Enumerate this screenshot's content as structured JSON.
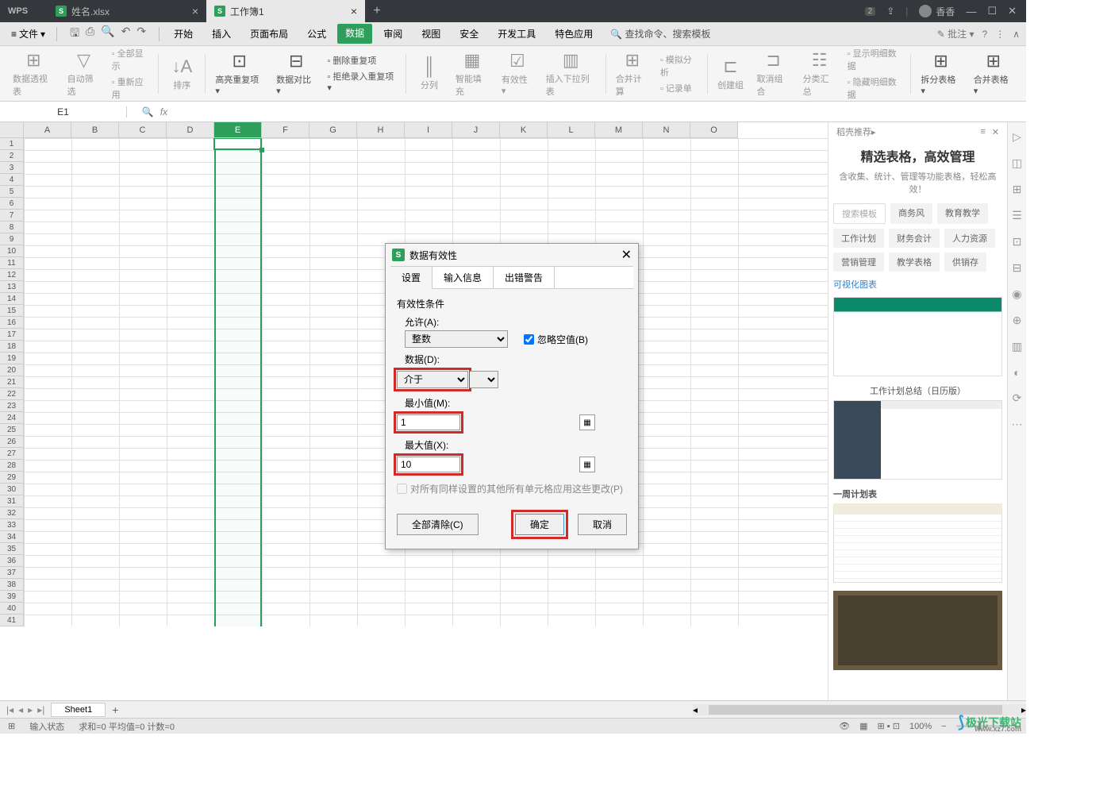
{
  "titlebar": {
    "logo": "WPS",
    "tabs": [
      {
        "name": "姓名.xlsx"
      },
      {
        "name": "工作簿1"
      }
    ],
    "badge": "2",
    "user": "香香"
  },
  "menubar": {
    "file": "文件",
    "items": [
      "开始",
      "插入",
      "页面布局",
      "公式",
      "数据",
      "审阅",
      "视图",
      "安全",
      "开发工具",
      "特色应用"
    ],
    "active_index": 4,
    "search": "查找命令、搜索模板",
    "comment": "批注"
  },
  "ribbon": {
    "groups": [
      {
        "label": "数据透视表",
        "icon": "⊞"
      },
      {
        "label": "自动筛选",
        "icon": "▽"
      },
      {
        "stack": [
          "全部显示",
          "重新应用"
        ]
      },
      {
        "label": "排序",
        "icon": "↓A",
        "sep_before": true
      },
      {
        "label": "高亮重复项",
        "icon": "⊡",
        "dd": true,
        "enabled": true,
        "sep_before": true
      },
      {
        "label": "数据对比",
        "icon": "⊟",
        "dd": true,
        "enabled": true
      },
      {
        "stack": [
          "删除重复项",
          "拒绝录入重复项"
        ],
        "enabled": true
      },
      {
        "label": "分列",
        "icon": "║",
        "sep_before": true
      },
      {
        "label": "智能填充",
        "icon": "▦"
      },
      {
        "label": "有效性",
        "icon": "☑",
        "dd": true
      },
      {
        "label": "插入下拉列表",
        "icon": "▥"
      },
      {
        "label": "合并计算",
        "icon": "⊞",
        "sep_before": true
      },
      {
        "stack": [
          "模拟分析",
          "记录单"
        ]
      },
      {
        "label": "创建组",
        "icon": "⊏",
        "sep_before": true
      },
      {
        "label": "取消组合",
        "icon": "⊐"
      },
      {
        "label": "分类汇总",
        "icon": "☷"
      },
      {
        "stack": [
          "显示明细数据",
          "隐藏明细数据"
        ]
      },
      {
        "label": "拆分表格",
        "icon": "⊞",
        "dd": true,
        "enabled": true,
        "sep_before": true
      },
      {
        "label": "合并表格",
        "icon": "⊞",
        "dd": true,
        "enabled": true
      }
    ]
  },
  "formula": {
    "namebox": "E1"
  },
  "grid": {
    "cols": [
      "A",
      "B",
      "C",
      "D",
      "E",
      "F",
      "G",
      "H",
      "I",
      "J",
      "K",
      "L",
      "M",
      "N",
      "O"
    ],
    "rows": 41,
    "sel_col_index": 4
  },
  "dialog": {
    "title": "数据有效性",
    "tabs": [
      "设置",
      "输入信息",
      "出错警告"
    ],
    "active_tab": 0,
    "section": "有效性条件",
    "allow_label": "允许(A):",
    "allow_value": "整数",
    "ignore_blank": "忽略空值(B)",
    "data_label": "数据(D):",
    "data_value": "介于",
    "min_label": "最小值(M):",
    "min_value": "1",
    "max_label": "最大值(X):",
    "max_value": "10",
    "apply_all": "对所有同样设置的其他所有单元格应用这些更改(P)",
    "clear_all": "全部清除(C)",
    "ok": "确定",
    "cancel": "取消"
  },
  "right_panel": {
    "header": "稻壳推荐",
    "title": "精选表格，高效管理",
    "subtitle": "含收集、统计、管理等功能表格，轻松高效！",
    "search_placeholder": "搜索模板",
    "tags": [
      "商务风",
      "教育教学",
      "工作计划",
      "财务会计",
      "人力资源",
      "营销管理",
      "教学表格",
      "供销存"
    ],
    "link": "可视化图表",
    "templates": [
      {
        "title": ""
      },
      {
        "title": "工作计划总结（日历版）"
      },
      {
        "title": "一周计划表"
      },
      {
        "title": ""
      }
    ]
  },
  "sheets": {
    "active": "Sheet1"
  },
  "statusbar": {
    "mode": "输入状态",
    "stats": "求和=0  平均值=0  计数=0",
    "zoom": "100%"
  },
  "watermark": {
    "text": "极光下载站",
    "url": "www.xz7.com"
  }
}
